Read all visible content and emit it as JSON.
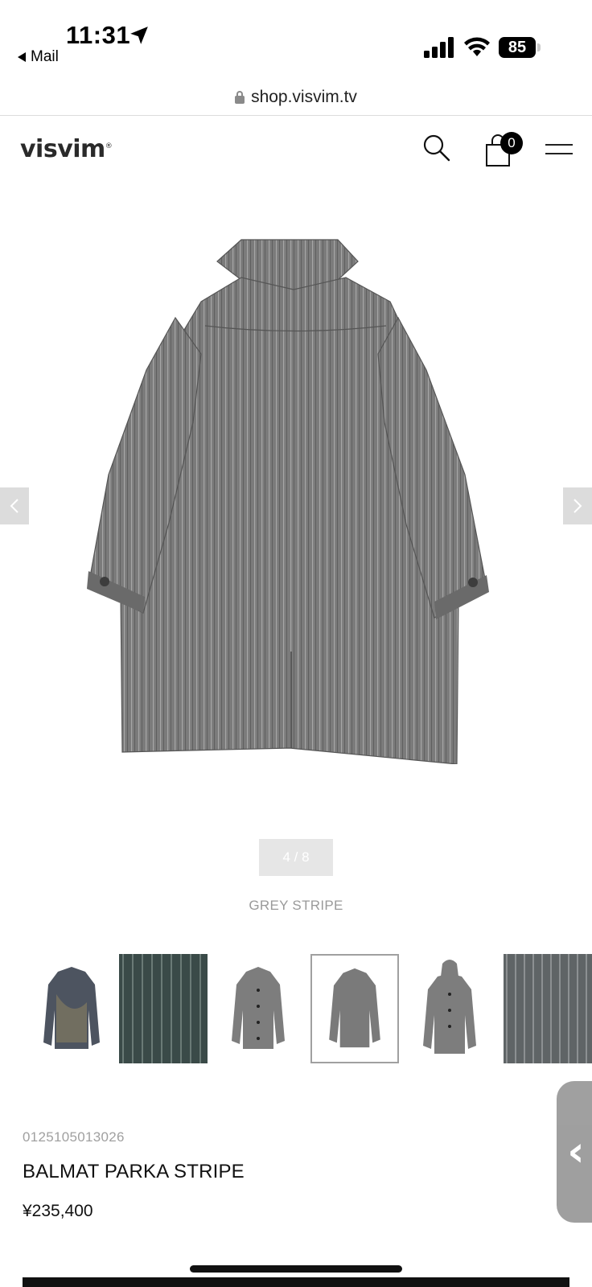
{
  "status_bar": {
    "time": "11:31",
    "back_app": "Mail",
    "battery": "85"
  },
  "url_bar": {
    "url": "shop.visvim.tv"
  },
  "header": {
    "logo": "visvim",
    "logo_mark": "®",
    "cart_count": "0",
    "icons": [
      "search-icon",
      "shopping-bag-icon",
      "hamburger-menu-icon"
    ]
  },
  "gallery": {
    "counter": "4 / 8",
    "color_name": "GREY STRIPE",
    "current_index": 4,
    "total": 8,
    "thumbnails": [
      {
        "label": "coat-front-dyed",
        "selected": false
      },
      {
        "label": "fabric-close-up-dark",
        "selected": false
      },
      {
        "label": "coat-front-grey",
        "selected": false
      },
      {
        "label": "coat-back-grey",
        "selected": true
      },
      {
        "label": "coat-hooded-grey",
        "selected": false
      },
      {
        "label": "fabric-close-up-grey",
        "selected": false
      }
    ]
  },
  "product": {
    "sku": "0125105013026",
    "name": "BALMAT PARKA STRIPE",
    "price": "¥235,400"
  },
  "colors": {
    "coat_grey": "#7b7b7b",
    "text_muted": "#9a9a9a",
    "accent": "#000000"
  }
}
